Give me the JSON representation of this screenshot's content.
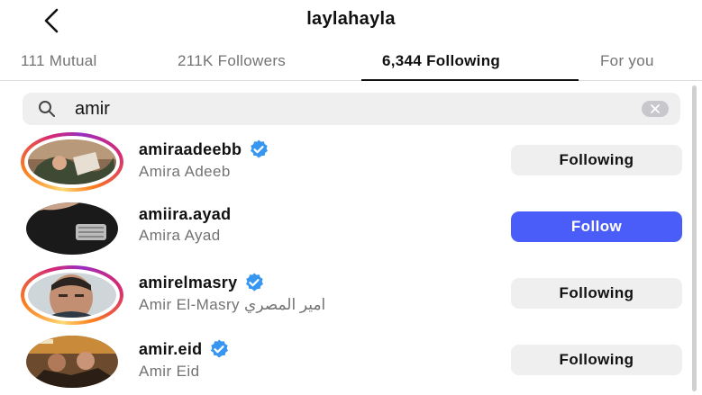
{
  "header": {
    "title": "laylahayla",
    "back_icon": "chevron-left-icon"
  },
  "tabs": [
    {
      "label": "111 Mutual",
      "active": false
    },
    {
      "label": "211K Followers",
      "active": false
    },
    {
      "label": "6,344 Following",
      "active": true
    },
    {
      "label": "For you",
      "active": false
    }
  ],
  "search": {
    "value": "amir",
    "icon": "search-icon",
    "clear_icon": "clear-icon"
  },
  "results": [
    {
      "username": "amiraadeebb",
      "verified": true,
      "full_name": "Amira Adeeb",
      "button": "Following",
      "story_ring": true
    },
    {
      "username": "amiira.ayad",
      "verified": false,
      "full_name": "Amira Ayad",
      "button": "Follow",
      "story_ring": false
    },
    {
      "username": "amirelmasry",
      "verified": true,
      "full_name": "Amir El-Masry امير المصري",
      "button": "Following",
      "story_ring": true
    },
    {
      "username": "amir.eid",
      "verified": true,
      "full_name": "Amir Eid",
      "button": "Following",
      "story_ring": false
    }
  ],
  "colors": {
    "follow_button": "#4a5df9",
    "following_button": "#efefef",
    "verified_badge": "#3797f0",
    "secondary_text": "#737373"
  }
}
